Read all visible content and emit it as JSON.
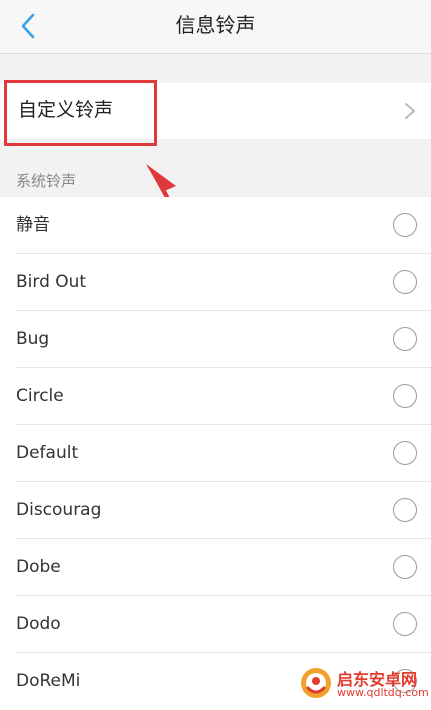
{
  "header": {
    "title": "信息铃声",
    "back_icon": "chevron-left-icon",
    "back_color": "#3aa0e6"
  },
  "custom": {
    "label": "自定义铃声",
    "chevron_icon": "chevron-right-icon"
  },
  "annotation": {
    "color": "#e0383b"
  },
  "section": {
    "label": "系统铃声"
  },
  "ringtones": [
    {
      "label": "静音"
    },
    {
      "label": "Bird Out"
    },
    {
      "label": "Bug"
    },
    {
      "label": "Circle"
    },
    {
      "label": "Default"
    },
    {
      "label": "Discourag"
    },
    {
      "label": "Dobe"
    },
    {
      "label": "Dodo"
    },
    {
      "label": "DoReMi"
    }
  ],
  "watermark": {
    "name": "启东安卓网",
    "url": "www.qdltdq.com",
    "color": "#e23b2e"
  }
}
